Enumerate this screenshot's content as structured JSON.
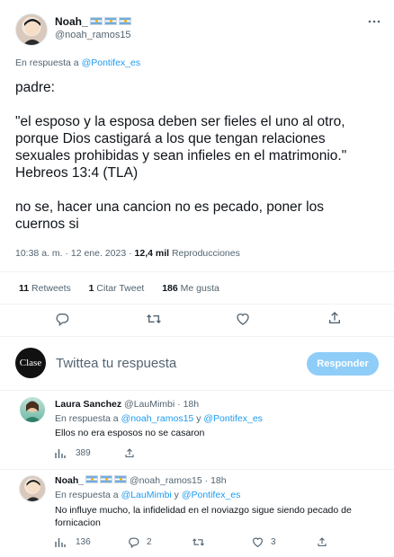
{
  "main_tweet": {
    "author_name": "Noah_",
    "handle": "@noah_ramos15",
    "reply_to_prefix": "En respuesta a",
    "reply_to_handle": "@Pontifex_es",
    "text_p1": "padre:",
    "text_p2_l1": "\"el esposo y la esposa deben ser fieles el uno al otro,",
    "text_p2_l2": "porque Dios castigará a los que tengan relaciones",
    "text_p2_l3": "sexuales prohibidas y sean infieles en el matrimonio.\"",
    "text_p2_l4": "Hebreos 13:4 (TLA)",
    "text_p3_l1": "no se, hacer una cancion no es pecado, poner los",
    "text_p3_l2": "cuernos si",
    "time": "10:38 a. m. · 12 ene. 2023 ·",
    "views_count": "12,4 mil",
    "views_label": "Reproducciones",
    "retweets_count": "11",
    "retweets_label": "Retweets",
    "quotes_count": "1",
    "quotes_label": "Citar Tweet",
    "likes_count": "186",
    "likes_label": "Me gusta"
  },
  "composer": {
    "avatar_text": "Clase",
    "placeholder": "Twittea tu respuesta",
    "button_label": "Responder"
  },
  "replies": [
    {
      "author_name": "Laura Sanchez",
      "handle": "@LauMimbi",
      "time": "· 18h",
      "reply_prefix": "En respuesta a",
      "reply_handle_1": "@noah_ramos15",
      "reply_join": "y",
      "reply_handle_2": "@Pontifex_es",
      "text": "Ellos no era esposos no se casaron",
      "views": "389"
    },
    {
      "author_name": "Noah_",
      "handle": "@noah_ramos15",
      "time": "· 18h",
      "reply_prefix": "En respuesta a",
      "reply_handle_1": "@LauMimbi",
      "reply_join": "y",
      "reply_handle_2": "@Pontifex_es",
      "text_l1": "No influye mucho, la infidelidad en el noviazgo sigue siendo pecado de",
      "text_l2": "fornicacion",
      "views": "136",
      "replies": "2",
      "likes": "3"
    }
  ],
  "colors": {
    "accent": "#1d9bf0",
    "secondary_text": "#536471",
    "button_disabled": "#8ecdf8"
  }
}
